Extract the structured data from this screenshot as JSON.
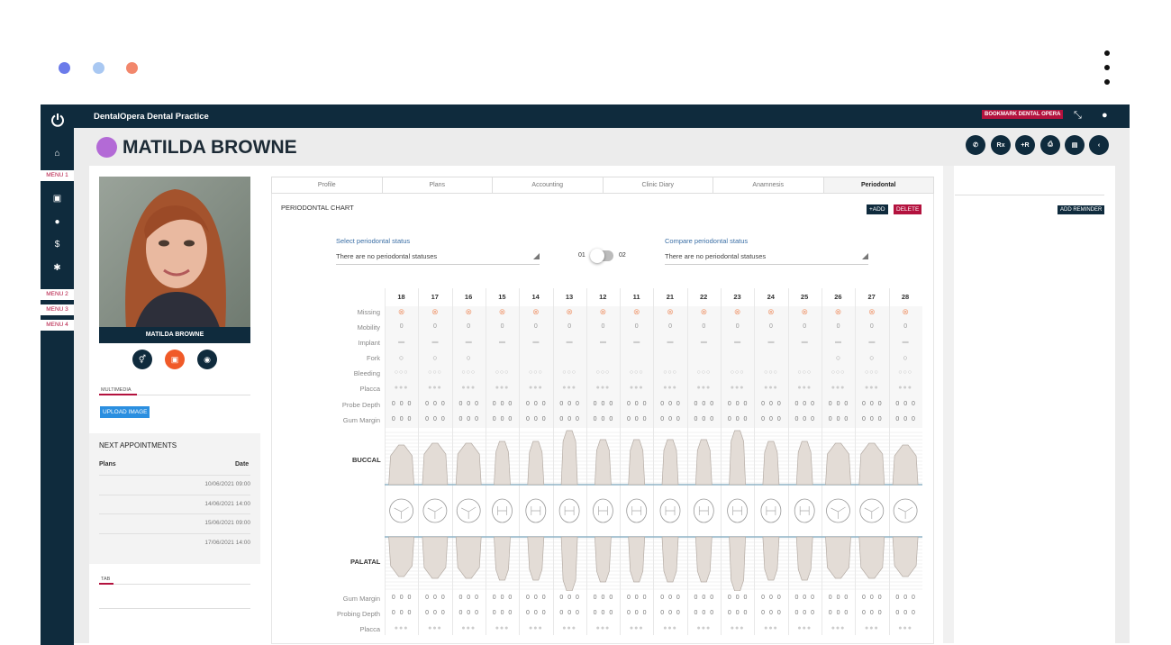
{
  "window": {
    "dots": [
      "#6b7bea",
      "#a9c8f2",
      "#f2876c"
    ]
  },
  "app": {
    "brand": "DentalOpera Dental Practice",
    "bookmark": "BOOKMARK DENTAL OPERA"
  },
  "sidebar": {
    "menus": [
      "MENU 1",
      "MENU 2",
      "MENU 3",
      "MENU 4"
    ]
  },
  "patient": {
    "name": "MATILDA BROWNE",
    "card_name": "MATILDA BROWNE"
  },
  "header_buttons": [
    "WA",
    "Rx",
    "+R",
    "print",
    "doc",
    "back"
  ],
  "left": {
    "multimedia": "MULTIMEDIA",
    "upload": "UPLOAD IMAGE",
    "appointments_title": "NEXT APPOINTMENTS",
    "col_plans": "Plans",
    "col_date": "Date",
    "appointments": [
      "10/06/2021 09:00",
      "14/06/2021 14:00",
      "15/06/2021 09:00",
      "17/06/2021 14:00"
    ],
    "tab": "TAB"
  },
  "tabs": [
    "Profile",
    "Plans",
    "Accounting",
    "Clinic Diary",
    "Anamnesis",
    "Periodontal"
  ],
  "chart": {
    "title": "PERIODONTAL CHART",
    "add": "+ADD",
    "delete": "DELETE",
    "select_label": "Select periodontal status",
    "select_value": "There are no periodontal statuses",
    "compare_label": "Compare periodontal status",
    "compare_value": "There are no periodontal statuses",
    "toggle_left": "01",
    "toggle_right": "02",
    "teeth": [
      "18",
      "17",
      "16",
      "15",
      "14",
      "13",
      "12",
      "11",
      "21",
      "22",
      "23",
      "24",
      "25",
      "26",
      "27",
      "28"
    ],
    "rows_top": [
      "Missing",
      "Mobility",
      "Implant",
      "Fork",
      "Bleeding",
      "Placca",
      "Probe Depth",
      "Gum Margin"
    ],
    "buccal": "BUCCAL",
    "palatal": "PALATAL",
    "rows_bottom": [
      "Gum Margin",
      "Probing Depth",
      "Placca"
    ],
    "mobility_value": "0",
    "depth_value": "0 0 0"
  },
  "right": {
    "reminder": "ADD REMINDER"
  }
}
